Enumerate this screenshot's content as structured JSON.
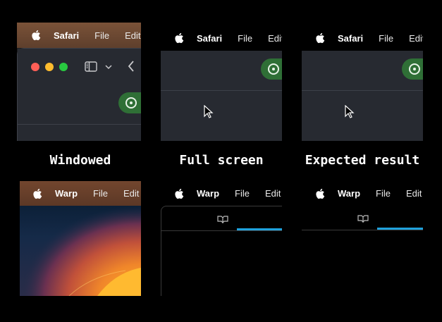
{
  "safari_row": {
    "menubar": {
      "app": "Safari",
      "items": [
        "File",
        "Edit"
      ]
    },
    "captions": [
      "Windowed",
      "Full screen",
      "Expected result"
    ]
  },
  "warp_row": {
    "menubar": {
      "app": "Warp",
      "items": [
        "File",
        "Edit"
      ]
    }
  },
  "icons": {
    "apple": "apple-logo-icon",
    "sidebar": "sidebar-toggle-icon",
    "chevron_down": "chevron-down-icon",
    "back": "chevron-left-icon",
    "shield": "privacy-icon",
    "cursor": "mouse-pointer-icon",
    "tab": "tab-book-icon"
  },
  "colors": {
    "menubar_safari": "#6b4a33",
    "menubar_warp": "#6d432c",
    "safari_bg": "#272a31",
    "pill": "#2f6f36",
    "warp_accent": "#1fa2dc",
    "close": "#ff5f57",
    "minimize": "#febc2e",
    "zoom": "#28c840"
  }
}
